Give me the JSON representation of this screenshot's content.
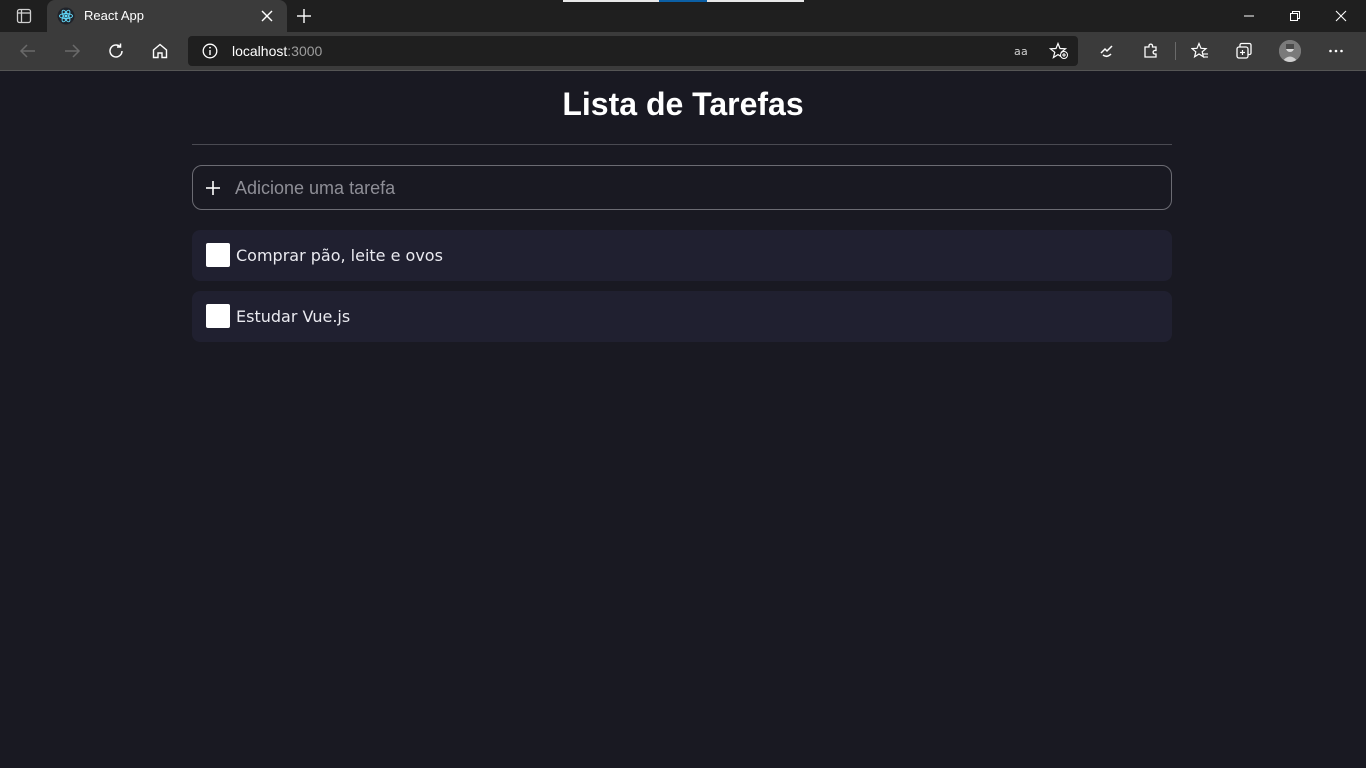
{
  "browser": {
    "tab_title": "React App",
    "url_host": "localhost",
    "url_port": ":3000"
  },
  "icons": {
    "tab_actions": "tab-actions-icon",
    "favicon": "react-icon",
    "close": "close-icon",
    "new_tab": "plus-icon",
    "back": "back-arrow-icon",
    "forward": "forward-arrow-icon",
    "refresh": "refresh-icon",
    "home": "home-icon",
    "site_info": "info-icon",
    "read_aloud": "translate-icon",
    "add_favorite": "star-add-icon",
    "browser_essentials": "heart-pulse-icon",
    "extensions": "puzzle-icon",
    "favorites": "favorites-icon",
    "collections": "collections-icon",
    "profile": "avatar",
    "more": "more-icon",
    "add_task": "plus-icon"
  },
  "app": {
    "title": "Lista de Tarefas",
    "add_placeholder": "Adicione uma tarefa",
    "tasks": [
      {
        "text": "Comprar pão, leite e ovos",
        "done": false
      },
      {
        "text": "Estudar Vue.js",
        "done": false
      }
    ]
  },
  "colors": {
    "background": "#191922",
    "task_bg": "#202030",
    "input_border": "#6b6b73"
  }
}
